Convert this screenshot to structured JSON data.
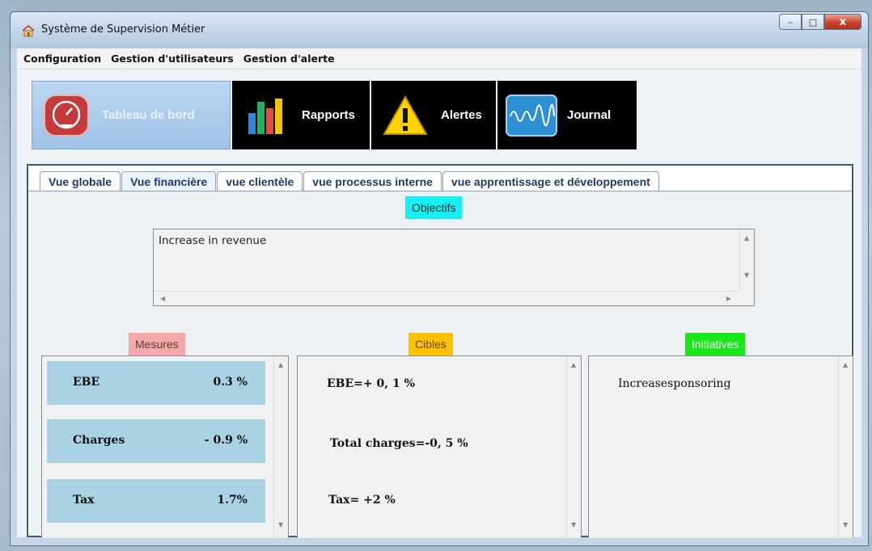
{
  "window": {
    "title": "Système de Supervision Métier",
    "controls": {
      "minimize": "–",
      "maximize": "□",
      "close": "x"
    }
  },
  "menu": [
    "Configuration",
    "Gestion d'utilisateurs",
    "Gestion d'alerte"
  ],
  "main_tabs": [
    {
      "label": "Tableau de bord",
      "icon": "gauge-icon",
      "active": true
    },
    {
      "label": "Rapports",
      "icon": "bar-chart-icon",
      "active": false
    },
    {
      "label": "Alertes",
      "icon": "warning-icon",
      "active": false
    },
    {
      "label": "Journal",
      "icon": "waveform-icon",
      "active": false
    }
  ],
  "sub_tabs": [
    {
      "label": "Vue globale",
      "active": false
    },
    {
      "label": "Vue financière",
      "active": true
    },
    {
      "label": "vue clientèle",
      "active": false
    },
    {
      "label": "vue processus interne",
      "active": false
    },
    {
      "label": "vue  apprentissage et développement",
      "active": false
    }
  ],
  "objectives": {
    "header": "Objectifs",
    "text": "Increase in revenue"
  },
  "mesures": {
    "header": "Mesures",
    "rows": [
      {
        "name": "EBE",
        "value": "0.3 %"
      },
      {
        "name": "Charges",
        "value": "- 0.9 %"
      },
      {
        "name": "Tax",
        "value": "1.7%"
      }
    ]
  },
  "cibles": {
    "header": "Cibles",
    "items": [
      "EBE=+ 0, 1 %",
      "Total charges=-0, 5 %",
      "Tax=  +2 %"
    ]
  },
  "initiatives": {
    "header": "Initiatives",
    "items": [
      "Increasesponsoring"
    ]
  },
  "colors": {
    "objectifs_chip": "#16f0f4",
    "mesures_chip": "#f4a8a8",
    "cibles_chip": "#ffc000",
    "initiatives_chip": "#18e818",
    "measure_row": "#a9d3e3"
  }
}
